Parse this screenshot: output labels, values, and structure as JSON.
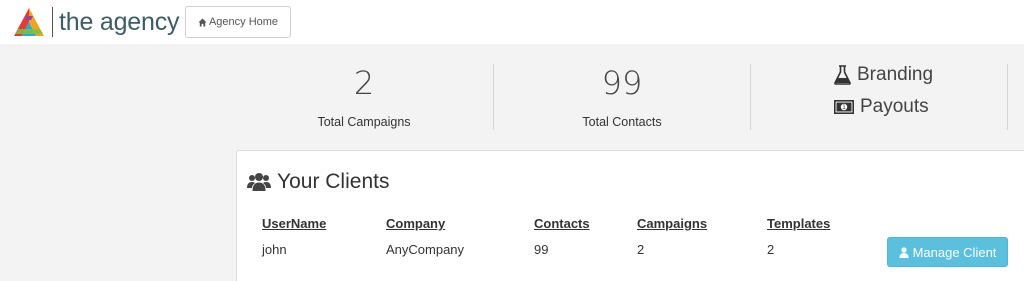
{
  "header": {
    "brand": "the agency",
    "home_button_label": "Agency Home"
  },
  "stats": [
    {
      "value": "2",
      "label": "Total Campaigns"
    },
    {
      "value": "99",
      "label": "Total Contacts"
    }
  ],
  "links": {
    "branding": "Branding",
    "payouts": "Payouts"
  },
  "clients_panel": {
    "title": "Your Clients",
    "columns": [
      "UserName",
      "Company",
      "Contacts",
      "Campaigns",
      "Templates"
    ],
    "rows": [
      {
        "username": "john",
        "company": "AnyCompany",
        "contacts": "99",
        "campaigns": "2",
        "templates": "2",
        "action_label": "Manage Client"
      }
    ]
  },
  "colors": {
    "brand_text": "#3b5d63",
    "manage_button": "#5bc0de",
    "page_background": "#f3f3f3"
  }
}
